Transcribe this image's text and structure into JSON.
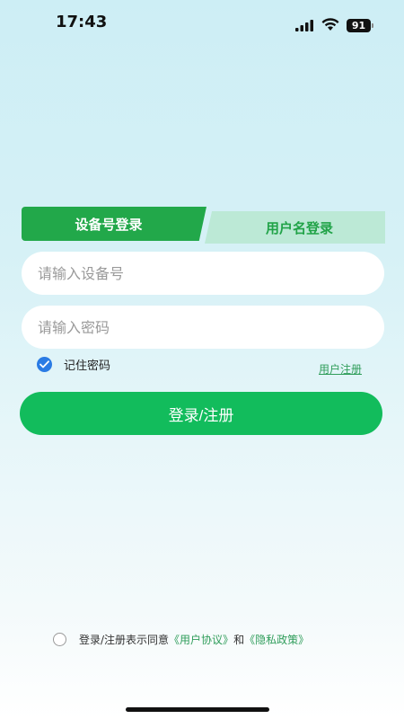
{
  "status_bar": {
    "time": "17:43",
    "battery": "91",
    "signal_icon": "signal-bars-icon",
    "wifi_icon": "wifi-icon"
  },
  "tabs": {
    "active_label": "设备号登录",
    "inactive_label": "用户名登录"
  },
  "form": {
    "device_placeholder": "请输入设备号",
    "device_value": "",
    "password_placeholder": "请输入密码",
    "password_value": "",
    "remember_label": "记住密码",
    "remember_checked": true,
    "register_link": "用户注册",
    "submit_label": "登录/注册"
  },
  "agreement": {
    "prefix": "登录/注册表示同意",
    "user_agreement": "《用户协议》",
    "and": "和",
    "privacy_policy": "《隐私政策》",
    "checked": false
  },
  "colors": {
    "accent_green": "#22a84a",
    "button_green": "#12bc5c",
    "tab_inactive": "#bce9d6",
    "link_green": "#2f9d5a",
    "checkbox_blue": "#2a7be4"
  }
}
